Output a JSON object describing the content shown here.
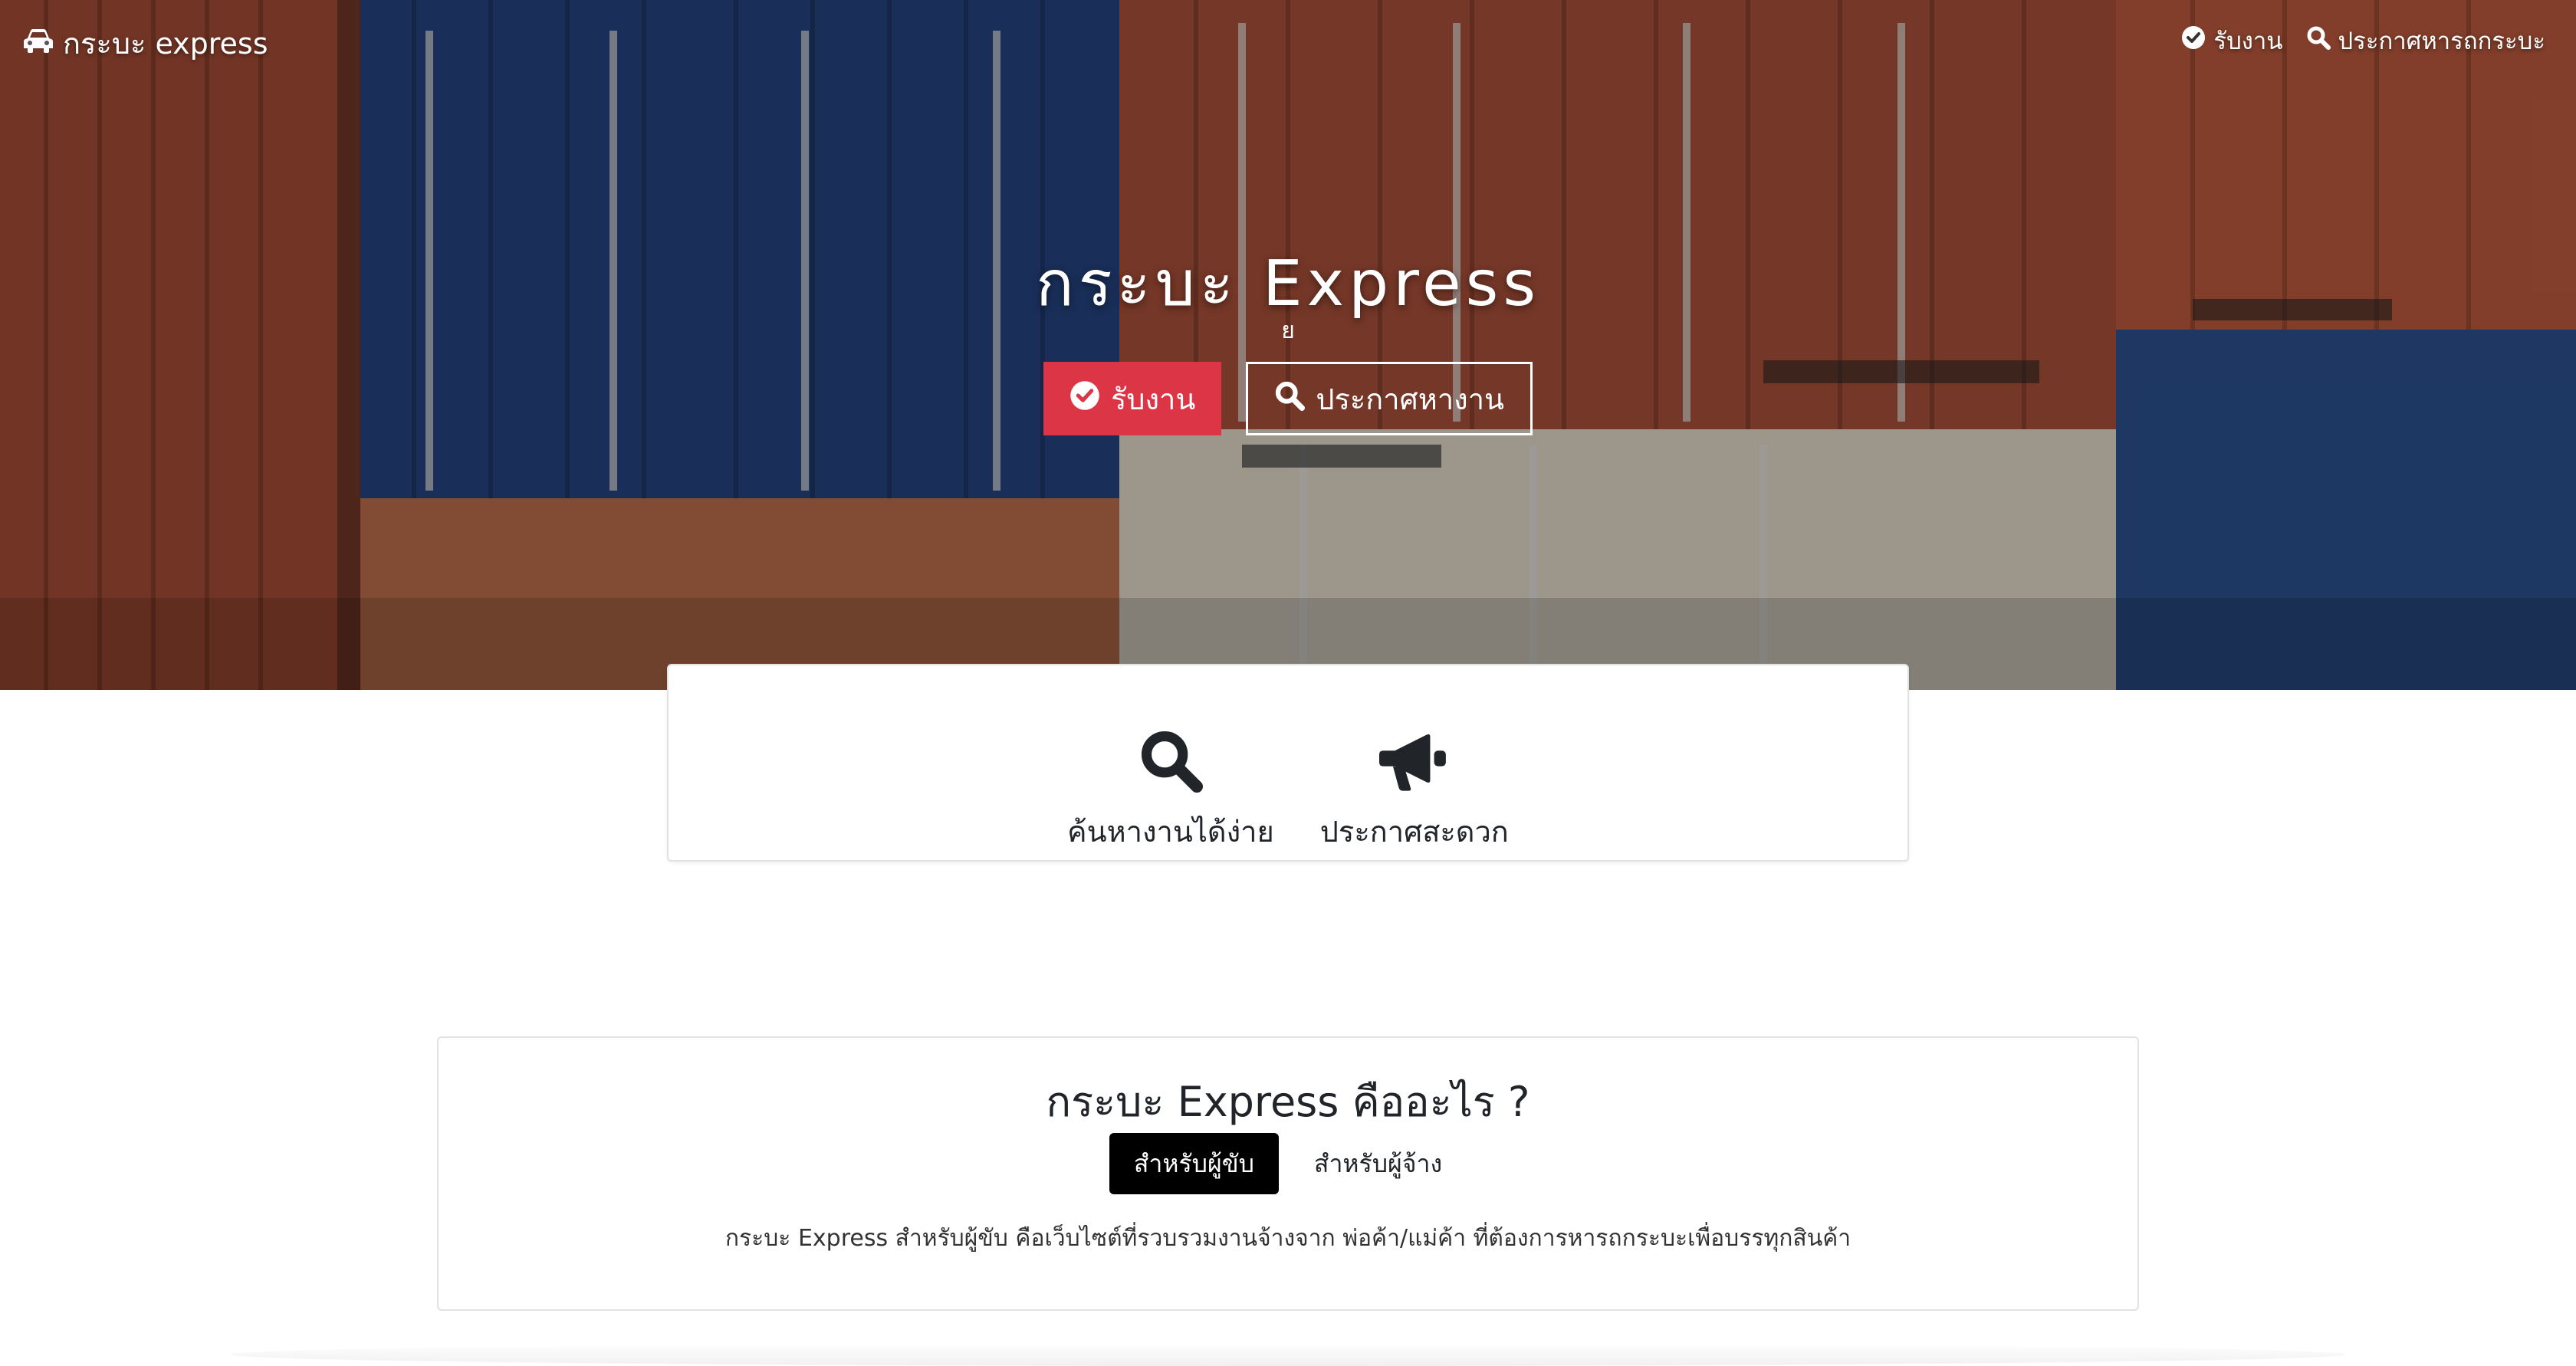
{
  "navbar": {
    "brand_label": "กระบะ express",
    "brand_icon": "car-icon",
    "links": [
      {
        "label": "รับงาน",
        "icon": "check-circle-icon"
      },
      {
        "label": "ประกาศหารถกระบะ",
        "icon": "search-icon"
      }
    ]
  },
  "hero": {
    "title": "กระบะ Express",
    "subtitle": "ย",
    "accept_button": "รับงาน",
    "post_button": "ประกาศหางาน"
  },
  "features": [
    {
      "label": "ค้นหางานได้ง่าย",
      "icon": "search-icon"
    },
    {
      "label": "ประกาศสะดวก",
      "icon": "megaphone-icon"
    }
  ],
  "about": {
    "title": "กระบะ Express คืออะไร ?",
    "tabs": [
      "สำหรับผู้ขับ",
      "สำหรับผู้จ้าง"
    ],
    "active_tab": "สำหรับผู้ขับ",
    "description": "กระบะ Express สำหรับผู้ขับ คือเว็บไซต์ที่รวบรวมงานจ้างจาก พ่อค้า/แม่ค้า ที่ต้องการหารถกระบะเพื่อบรรทุกสินค้า"
  },
  "colors": {
    "accept_button": "#dc3545",
    "active_tab": "#000000",
    "container_red": "#a4513a",
    "container_blue": "#22407a",
    "container_cream": "#d9d1c2"
  }
}
